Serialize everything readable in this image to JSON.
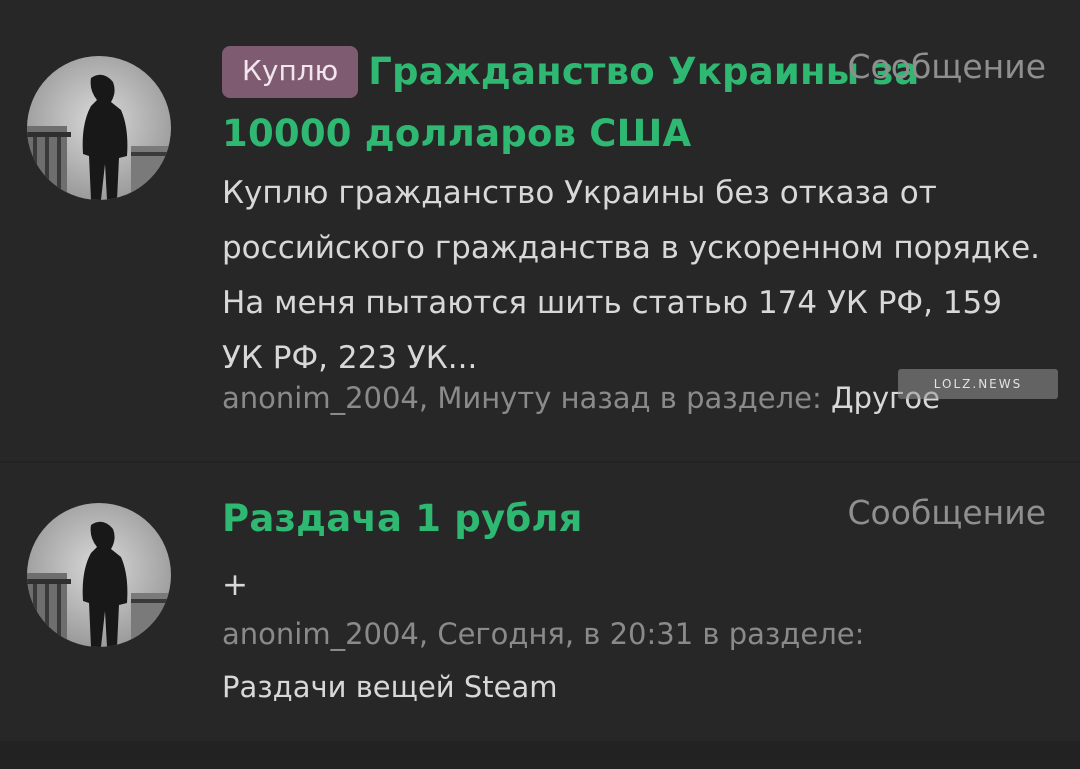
{
  "posts": [
    {
      "prefix_tag": "Куплю",
      "title": "Гражданство Украины за 10000 долларов США",
      "type": "Сообщение",
      "body": "Куплю гражданство Украины без отказа от российского гражданства в ускоренном порядке. На меня пытаются шить статью 174 УК РФ, 159 УК РФ, 223 УК...",
      "author": "anonim_2004",
      "meta_text": ", Минуту назад в разделе: ",
      "section": "Другое"
    },
    {
      "title": "Раздача 1 рубля",
      "type": "Сообщение",
      "body": "+",
      "author": "anonim_2004",
      "meta_text": ", Сегодня, в 20:31 в разделе:",
      "section": "Раздачи вещей Steam"
    }
  ],
  "watermark": "LOLZ.NEWS",
  "colors": {
    "title_green": "#2eb872",
    "tag_bg": "#7f5b71",
    "background": "#272727",
    "muted_text": "#8a8a8a",
    "body_text": "#d8d8d8"
  },
  "icons": {
    "avatar": "user-avatar-photo"
  }
}
